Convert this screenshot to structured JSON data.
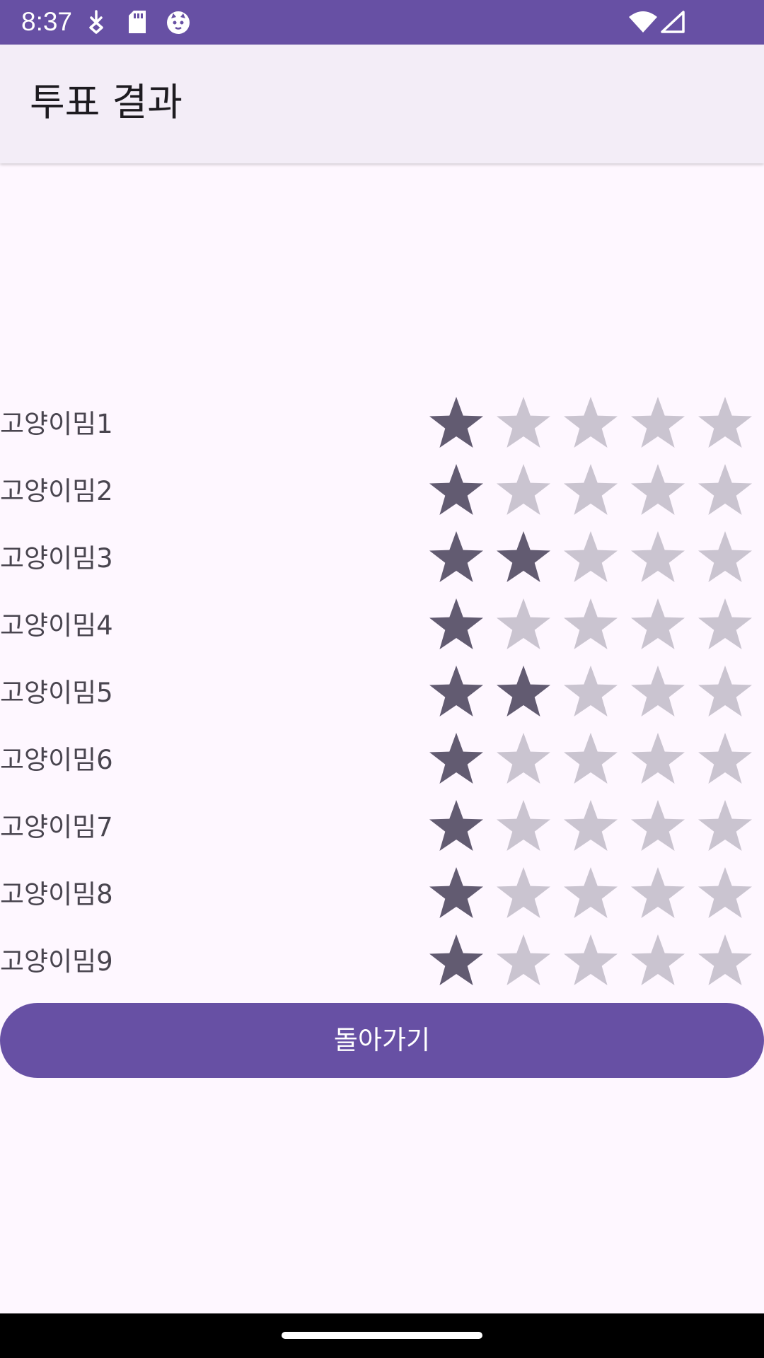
{
  "status_bar": {
    "time": "8:37",
    "left_icons": [
      "download-icon",
      "sd-card-icon",
      "cat-face-icon"
    ],
    "right_icons": [
      "wifi-icon",
      "cell-signal-icon"
    ],
    "color": "#6750A4"
  },
  "app_bar": {
    "title": "투표 결과",
    "background": "#F3EDF7"
  },
  "votes": {
    "max_stars": 5,
    "filled_color": "#625B71",
    "empty_color": "#CAC4D0",
    "items": [
      {
        "label": "고양이밈1",
        "rating": 1
      },
      {
        "label": "고양이밈2",
        "rating": 1
      },
      {
        "label": "고양이밈3",
        "rating": 2
      },
      {
        "label": "고양이밈4",
        "rating": 1
      },
      {
        "label": "고양이밈5",
        "rating": 2
      },
      {
        "label": "고양이밈6",
        "rating": 1
      },
      {
        "label": "고양이밈7",
        "rating": 1
      },
      {
        "label": "고양이밈8",
        "rating": 1
      },
      {
        "label": "고양이밈9",
        "rating": 1
      }
    ]
  },
  "back_button": {
    "label": "돌아가기",
    "color": "#6750A4"
  }
}
